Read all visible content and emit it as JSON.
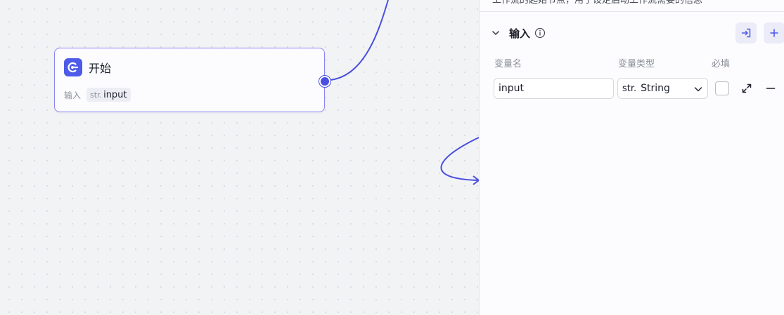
{
  "canvas": {
    "start_node": {
      "title": "开始",
      "inputs_label": "输入",
      "variable": {
        "type": "str.",
        "name": "input"
      }
    }
  },
  "panel": {
    "description": "工作流的起始节点，用于设定启动工作流需要的信息",
    "section": {
      "title": "输入",
      "icons": {
        "collapse": "chevron-down-icon",
        "info": "info-icon",
        "import": "import-icon",
        "add": "plus-icon"
      },
      "columns": {
        "name": "变量名",
        "type": "变量类型",
        "required": "必填"
      },
      "rows": [
        {
          "name": "input",
          "type_prefix": "str.",
          "type": "String",
          "required": false
        }
      ]
    }
  },
  "colors": {
    "accent": "#4e5ae8",
    "edge": "#4a4fe0",
    "node_border": "#8b87f0"
  }
}
